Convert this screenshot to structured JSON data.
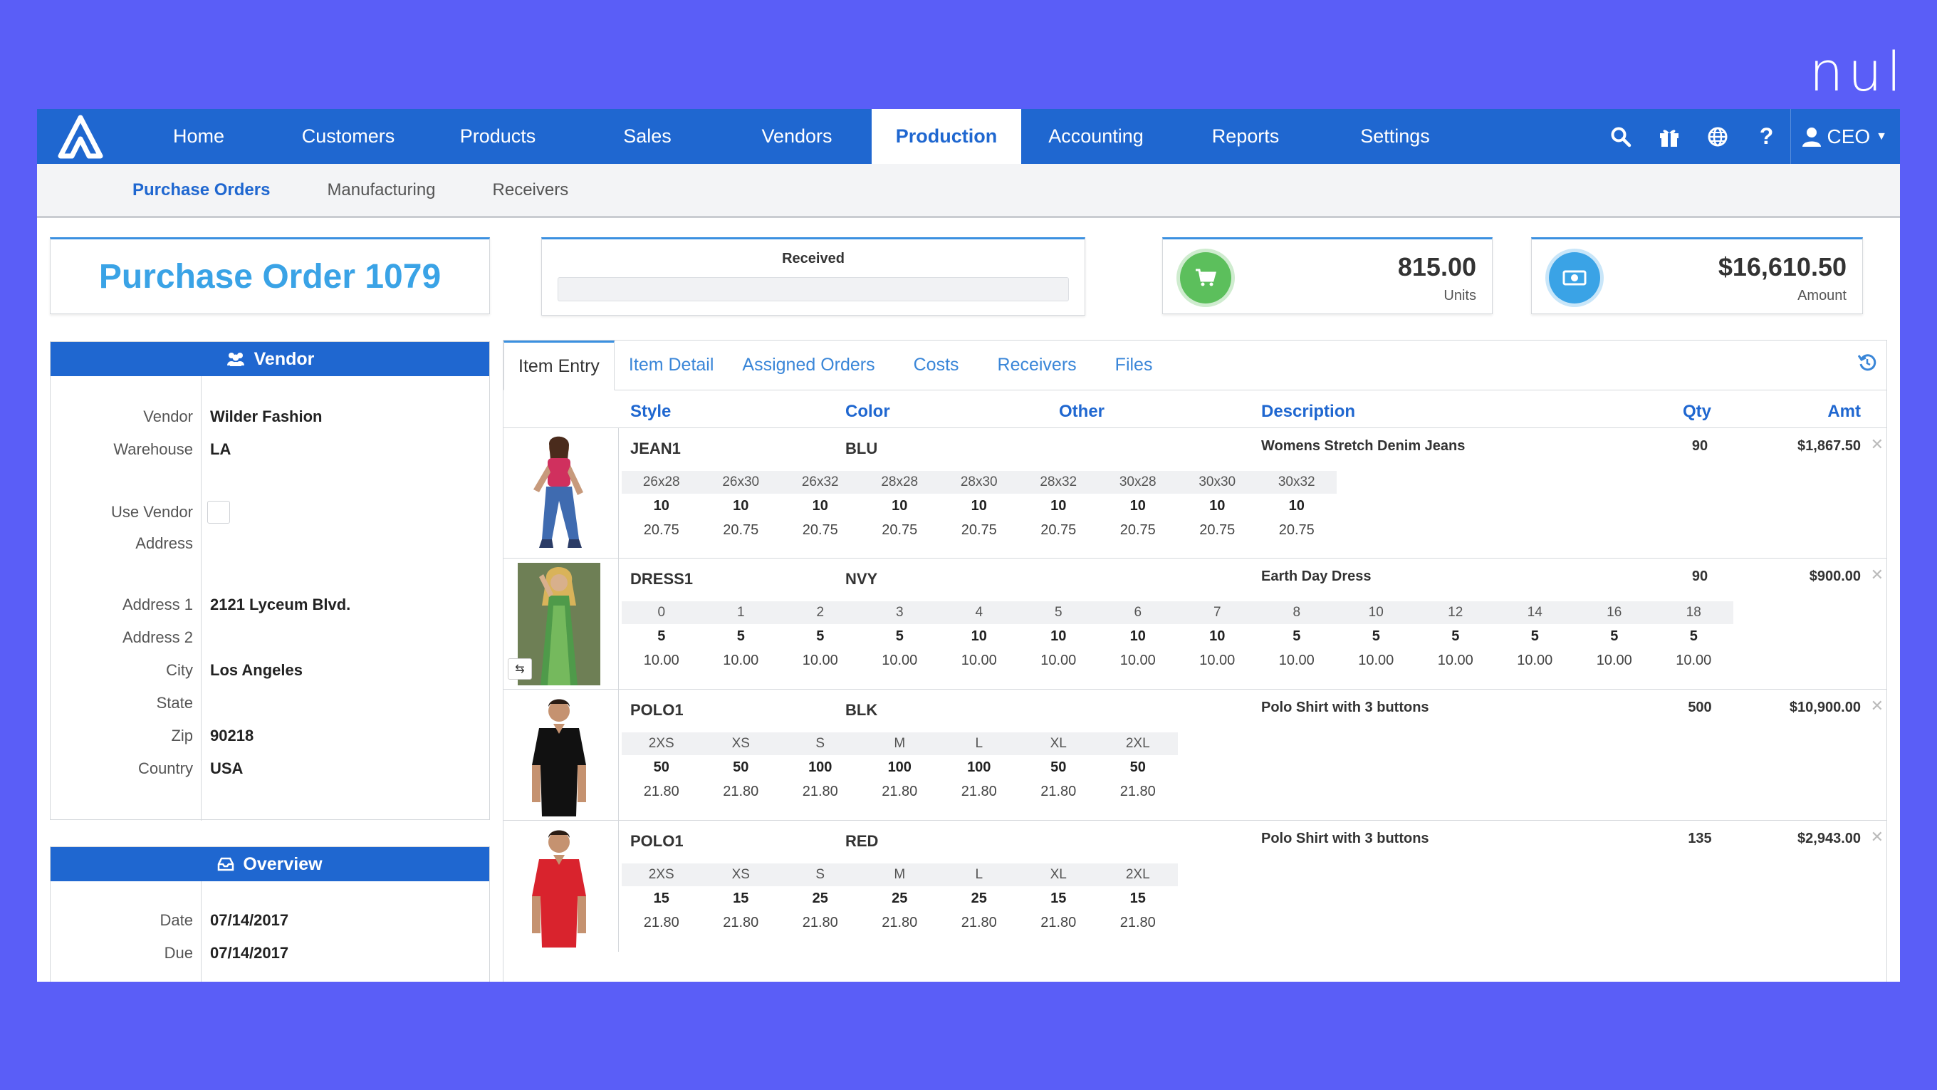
{
  "brand": "nul",
  "topnav": {
    "items": [
      "Home",
      "Customers",
      "Products",
      "Sales",
      "Vendors",
      "Production",
      "Accounting",
      "Reports",
      "Settings"
    ],
    "active": "Production",
    "user": "CEO"
  },
  "subnav": {
    "items": [
      "Purchase Orders",
      "Manufacturing",
      "Receivers"
    ],
    "active": "Purchase Orders"
  },
  "po_title": "Purchase Order 1079",
  "received": {
    "label": "Received",
    "progress": 0
  },
  "units": {
    "value": "815.00",
    "label": "Units"
  },
  "amount": {
    "value": "$16,610.50",
    "label": "Amount"
  },
  "vendor_panel": {
    "title": "Vendor",
    "fields": {
      "vendor": {
        "label": "Vendor",
        "value": "Wilder Fashion"
      },
      "warehouse": {
        "label": "Warehouse",
        "value": "LA"
      },
      "use_vendor": {
        "label": "Use Vendor"
      },
      "address": {
        "label": "Address"
      },
      "address1": {
        "label": "Address 1",
        "value": "2121 Lyceum Blvd."
      },
      "address2": {
        "label": "Address 2",
        "value": ""
      },
      "city": {
        "label": "City",
        "value": "Los Angeles"
      },
      "state": {
        "label": "State",
        "value": ""
      },
      "zip": {
        "label": "Zip",
        "value": "90218"
      },
      "country": {
        "label": "Country",
        "value": "USA"
      }
    }
  },
  "overview_panel": {
    "title": "Overview",
    "fields": {
      "date": {
        "label": "Date",
        "value": "07/14/2017"
      },
      "due": {
        "label": "Due",
        "value": "07/14/2017"
      }
    }
  },
  "tabs": [
    "Item Entry",
    "Item Detail",
    "Assigned Orders",
    "Costs",
    "Receivers",
    "Files"
  ],
  "active_tab": "Item Entry",
  "columns": {
    "style": "Style",
    "color": "Color",
    "other": "Other",
    "description": "Description",
    "qty": "Qty",
    "amt": "Amt"
  },
  "items": [
    {
      "style": "JEAN1",
      "color": "BLU",
      "description": "Womens Stretch Denim Jeans",
      "qty": "90",
      "amt": "$1,867.50",
      "sizes": [
        "26x28",
        "26x30",
        "26x32",
        "28x28",
        "28x30",
        "28x32",
        "30x28",
        "30x30",
        "30x32"
      ],
      "quantities": [
        "10",
        "10",
        "10",
        "10",
        "10",
        "10",
        "10",
        "10",
        "10"
      ],
      "prices": [
        "20.75",
        "20.75",
        "20.75",
        "20.75",
        "20.75",
        "20.75",
        "20.75",
        "20.75",
        "20.75"
      ]
    },
    {
      "style": "DRESS1",
      "color": "NVY",
      "description": "Earth Day Dress",
      "qty": "90",
      "amt": "$900.00",
      "sizes": [
        "0",
        "1",
        "2",
        "3",
        "4",
        "5",
        "6",
        "7",
        "8",
        "10",
        "12",
        "14",
        "16",
        "18"
      ],
      "quantities": [
        "5",
        "5",
        "5",
        "5",
        "10",
        "10",
        "10",
        "10",
        "5",
        "5",
        "5",
        "5",
        "5",
        "5"
      ],
      "prices": [
        "10.00",
        "10.00",
        "10.00",
        "10.00",
        "10.00",
        "10.00",
        "10.00",
        "10.00",
        "10.00",
        "10.00",
        "10.00",
        "10.00",
        "10.00",
        "10.00"
      ]
    },
    {
      "style": "POLO1",
      "color": "BLK",
      "description": "Polo Shirt with 3 buttons",
      "qty": "500",
      "amt": "$10,900.00",
      "sizes": [
        "2XS",
        "XS",
        "S",
        "M",
        "L",
        "XL",
        "2XL"
      ],
      "quantities": [
        "50",
        "50",
        "100",
        "100",
        "100",
        "50",
        "50"
      ],
      "prices": [
        "21.80",
        "21.80",
        "21.80",
        "21.80",
        "21.80",
        "21.80",
        "21.80"
      ]
    },
    {
      "style": "POLO1",
      "color": "RED",
      "description": "Polo Shirt with 3 buttons",
      "qty": "135",
      "amt": "$2,943.00",
      "sizes": [
        "2XS",
        "XS",
        "S",
        "M",
        "L",
        "XL",
        "2XL"
      ],
      "quantities": [
        "15",
        "15",
        "25",
        "25",
        "25",
        "15",
        "15"
      ],
      "prices": [
        "21.80",
        "21.80",
        "21.80",
        "21.80",
        "21.80",
        "21.80",
        "21.80"
      ]
    }
  ],
  "colors": {
    "nav": "#1f67d0",
    "accent": "#3aa3e6",
    "units_icon": "#5cbf5c",
    "background": "#5a5ef7"
  }
}
